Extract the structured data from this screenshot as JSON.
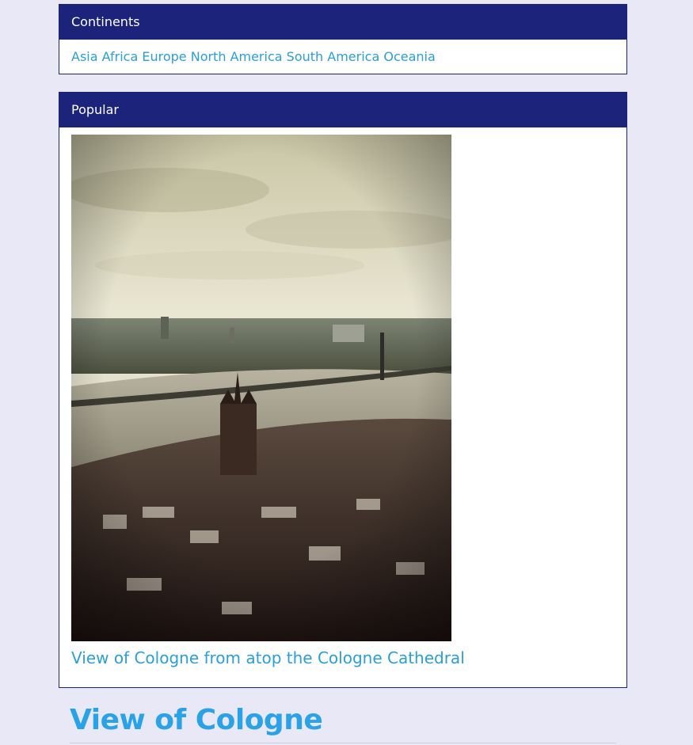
{
  "continents": {
    "header": "Continents",
    "links": [
      "Asia",
      "Africa",
      "Europe",
      "North America",
      "South America",
      "Oceania"
    ]
  },
  "popular": {
    "header": "Popular",
    "caption": "View of Cologne from atop the Cologne Cathedral"
  },
  "page": {
    "title": "View of Cologne"
  },
  "colors": {
    "panel_header": "#1b237b",
    "link": "#2a9fd8",
    "page_background": "#e8e8f6"
  }
}
